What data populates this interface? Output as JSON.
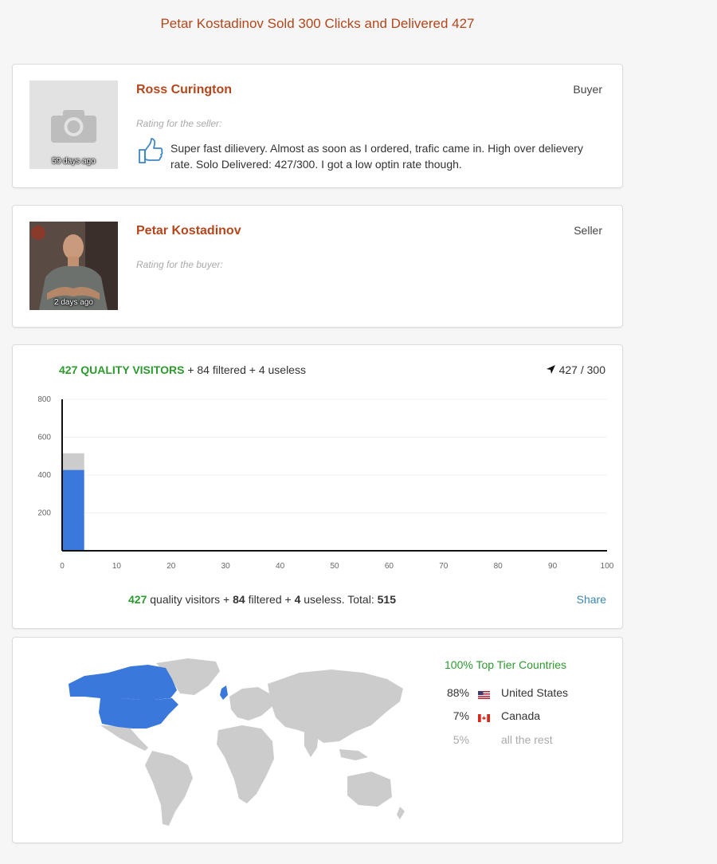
{
  "page": {
    "title": "Petar Kostadinov Sold 300 Clicks and Delivered 427"
  },
  "buyer_review": {
    "name": "Ross Curington",
    "role": "Buyer",
    "days_ago": "59 days ago",
    "rating_label": "Rating for the seller:",
    "rating_icon": "thumbs-up-icon",
    "text": "Super fast dilievery. Almost as soon as I ordered, trafic came in. High over delievery rate. Solo Delivered: 427/300. I got a low optin rate though."
  },
  "seller_review": {
    "name": "Petar Kostadinov",
    "role": "Seller",
    "days_ago": "2 days ago",
    "rating_label": "Rating for the buyer:"
  },
  "visitors": {
    "quality_label": "427 QUALITY VISITORS",
    "extra_label": "+ 84 filtered + 4 useless",
    "delivered": "427 / 300",
    "summary": {
      "quality": "427",
      "quality_text": "quality visitors +",
      "filtered": "84",
      "filtered_text": "filtered +",
      "useless": "4",
      "useless_text": "useless. Total:",
      "total": "515"
    },
    "share_label": "Share"
  },
  "chart_data": {
    "type": "bar",
    "stacked": true,
    "x_ticks": [
      "0",
      "10",
      "20",
      "30",
      "40",
      "50",
      "60",
      "70",
      "80",
      "90",
      "100"
    ],
    "y_ticks": [
      "800",
      "600",
      "400",
      "200"
    ],
    "xlim": [
      0,
      100
    ],
    "ylim": [
      0,
      800
    ],
    "series": [
      {
        "values": [
          {
            "x": 2,
            "y": 427
          }
        ],
        "color": "#3a78dc"
      },
      {
        "values": [
          {
            "x": 2,
            "y": 88
          }
        ],
        "color": "#cccccc"
      }
    ],
    "grid": true,
    "legend": "none"
  },
  "geo": {
    "header": "100% Top Tier Countries",
    "countries": [
      {
        "pct": "88%",
        "name": "United States",
        "flag": "us-flag-icon"
      },
      {
        "pct": "7%",
        "name": "Canada",
        "flag": "canada-flag-icon"
      }
    ],
    "rest": {
      "pct": "5%",
      "name": "all the rest"
    },
    "colors": {
      "highlight": "#3a78dc",
      "other": "#cccccc"
    }
  }
}
